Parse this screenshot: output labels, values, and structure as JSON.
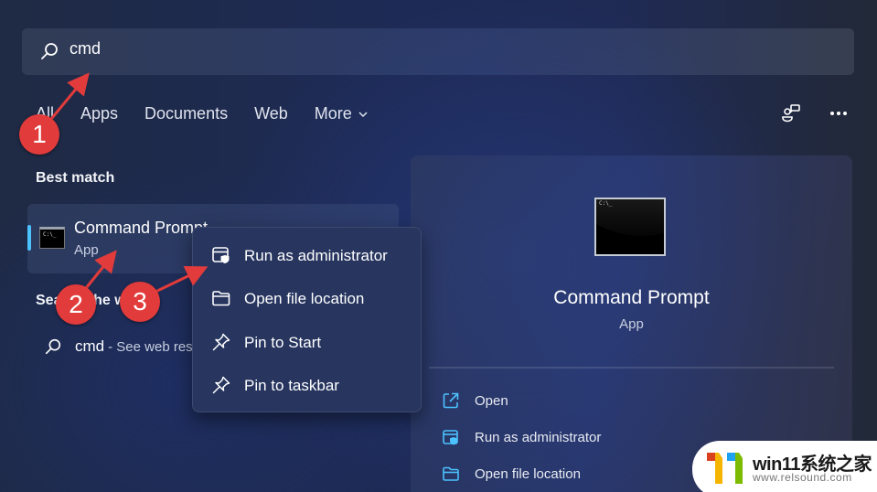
{
  "search": {
    "value": "cmd",
    "icon": "search-icon"
  },
  "tabs": [
    {
      "label": "All"
    },
    {
      "label": "Apps"
    },
    {
      "label": "Documents"
    },
    {
      "label": "Web"
    },
    {
      "label": "More",
      "icon": "chevron-down-icon"
    }
  ],
  "top_right_icons": [
    "people-chat-icon",
    "more-ellipsis-icon"
  ],
  "best_match": {
    "section_title": "Best match",
    "name": "Command Prompt",
    "type": "App",
    "accent_color": "#4cc2ff"
  },
  "web_search": {
    "section_title": "Search the web",
    "query": "cmd",
    "suffix": "- See web res"
  },
  "context_menu": {
    "items": [
      {
        "label": "Run as administrator",
        "icon": "shield-window-icon"
      },
      {
        "label": "Open file location",
        "icon": "folder-icon"
      },
      {
        "label": "Pin to Start",
        "icon": "pin-icon"
      },
      {
        "label": "Pin to taskbar",
        "icon": "pin-icon"
      }
    ]
  },
  "detail": {
    "title": "Command Prompt",
    "subtitle": "App",
    "actions": [
      {
        "label": "Open",
        "icon": "open-external-icon"
      },
      {
        "label": "Run as administrator",
        "icon": "shield-window-icon"
      },
      {
        "label": "Open file location",
        "icon": "folder-icon"
      }
    ],
    "icon_accent": "#4cc2ff"
  },
  "annotations": [
    {
      "number": "1",
      "target": "search input"
    },
    {
      "number": "2",
      "target": "Command Prompt result"
    },
    {
      "number": "3",
      "target": "Run as administrator"
    }
  ],
  "annotation_color": "#e23b3b",
  "watermark": {
    "title": "win11系统之家",
    "url": "www.relsound.com"
  }
}
